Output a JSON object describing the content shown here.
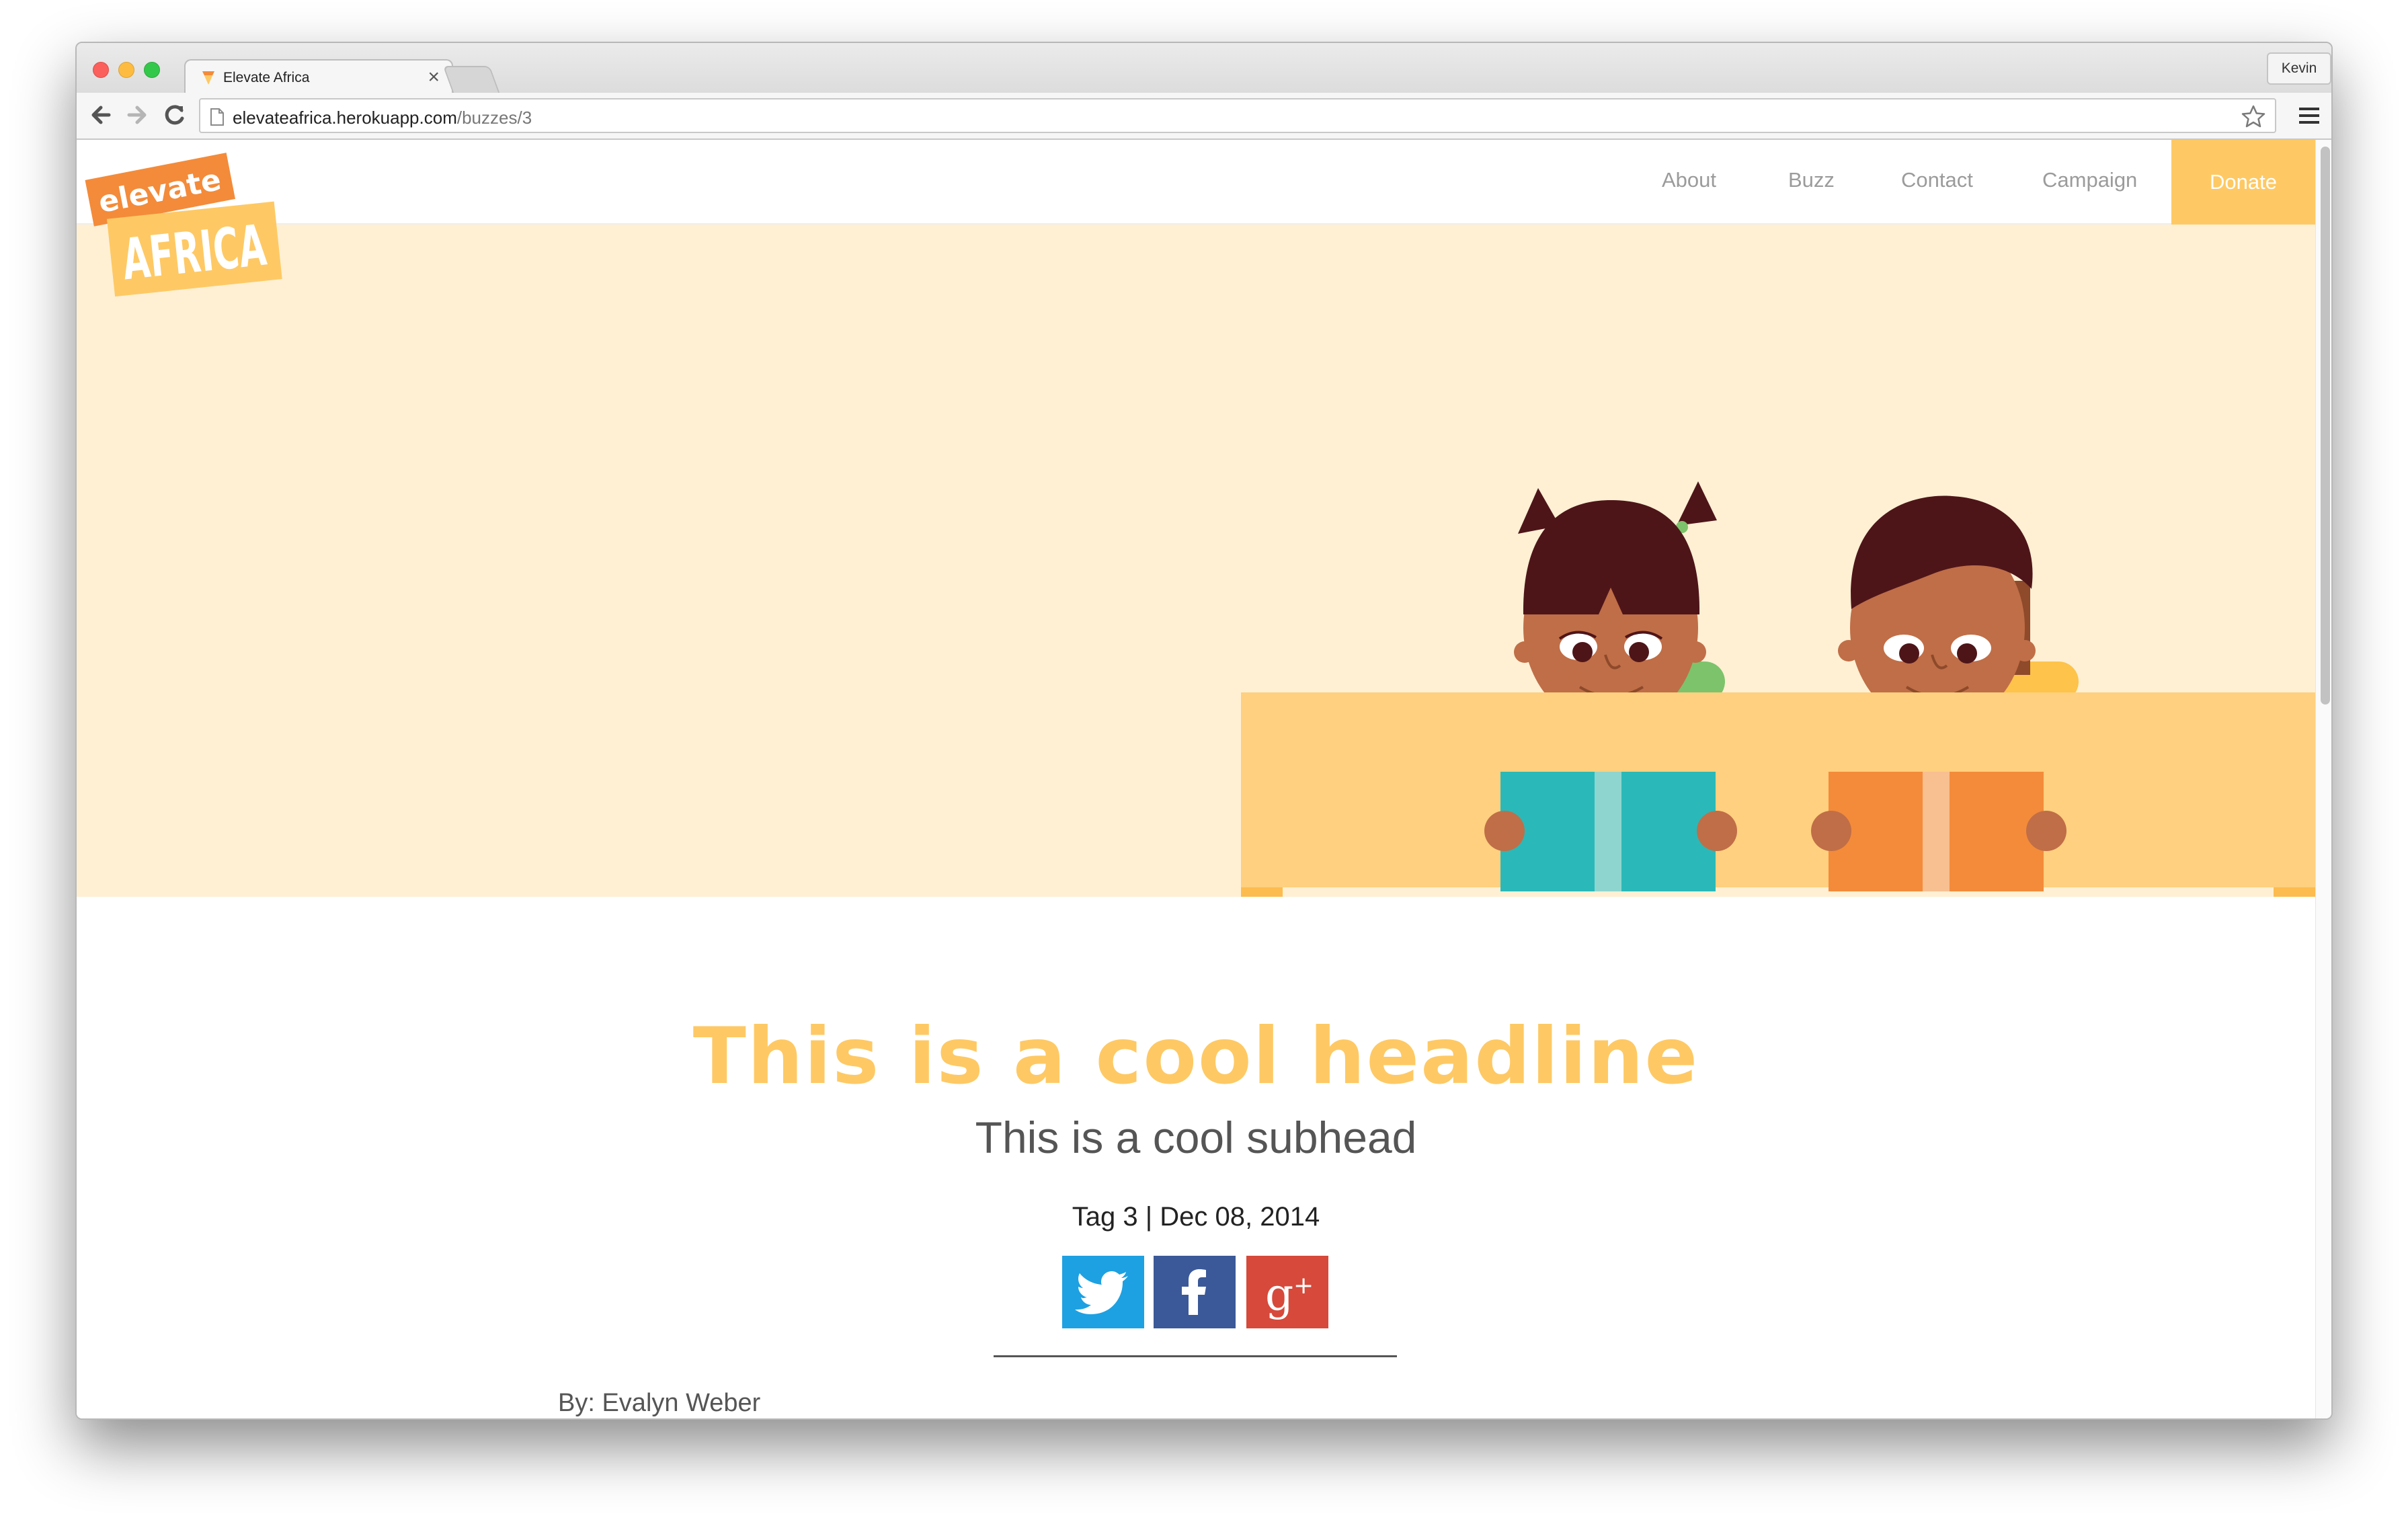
{
  "browser": {
    "tab_title": "Elevate Africa",
    "tab_close": "×",
    "profile_name": "Kevin",
    "url_host": "elevateafrica.herokuapp.com",
    "url_path": "/buzzes/3"
  },
  "logo": {
    "top_text": "elevate",
    "bottom_text": "AFRICA"
  },
  "nav": {
    "items": [
      {
        "label": "About"
      },
      {
        "label": "Buzz"
      },
      {
        "label": "Contact"
      },
      {
        "label": "Campaign"
      }
    ],
    "donate_label": "Donate"
  },
  "article": {
    "headline": "This is a cool headline",
    "subhead": "This is a cool subhead",
    "meta": "Tag 3 | Dec 08, 2014",
    "byline": "By: Evalyn Weber"
  },
  "share": [
    "twitter-icon",
    "facebook-icon",
    "google-plus-icon"
  ],
  "colors": {
    "accent": "#fec964",
    "hero_bg": "#fff0d4",
    "logo_orange": "#f38b3a",
    "twitter": "#1da1e2",
    "facebook": "#3b5998",
    "google_plus": "#d6493b"
  }
}
